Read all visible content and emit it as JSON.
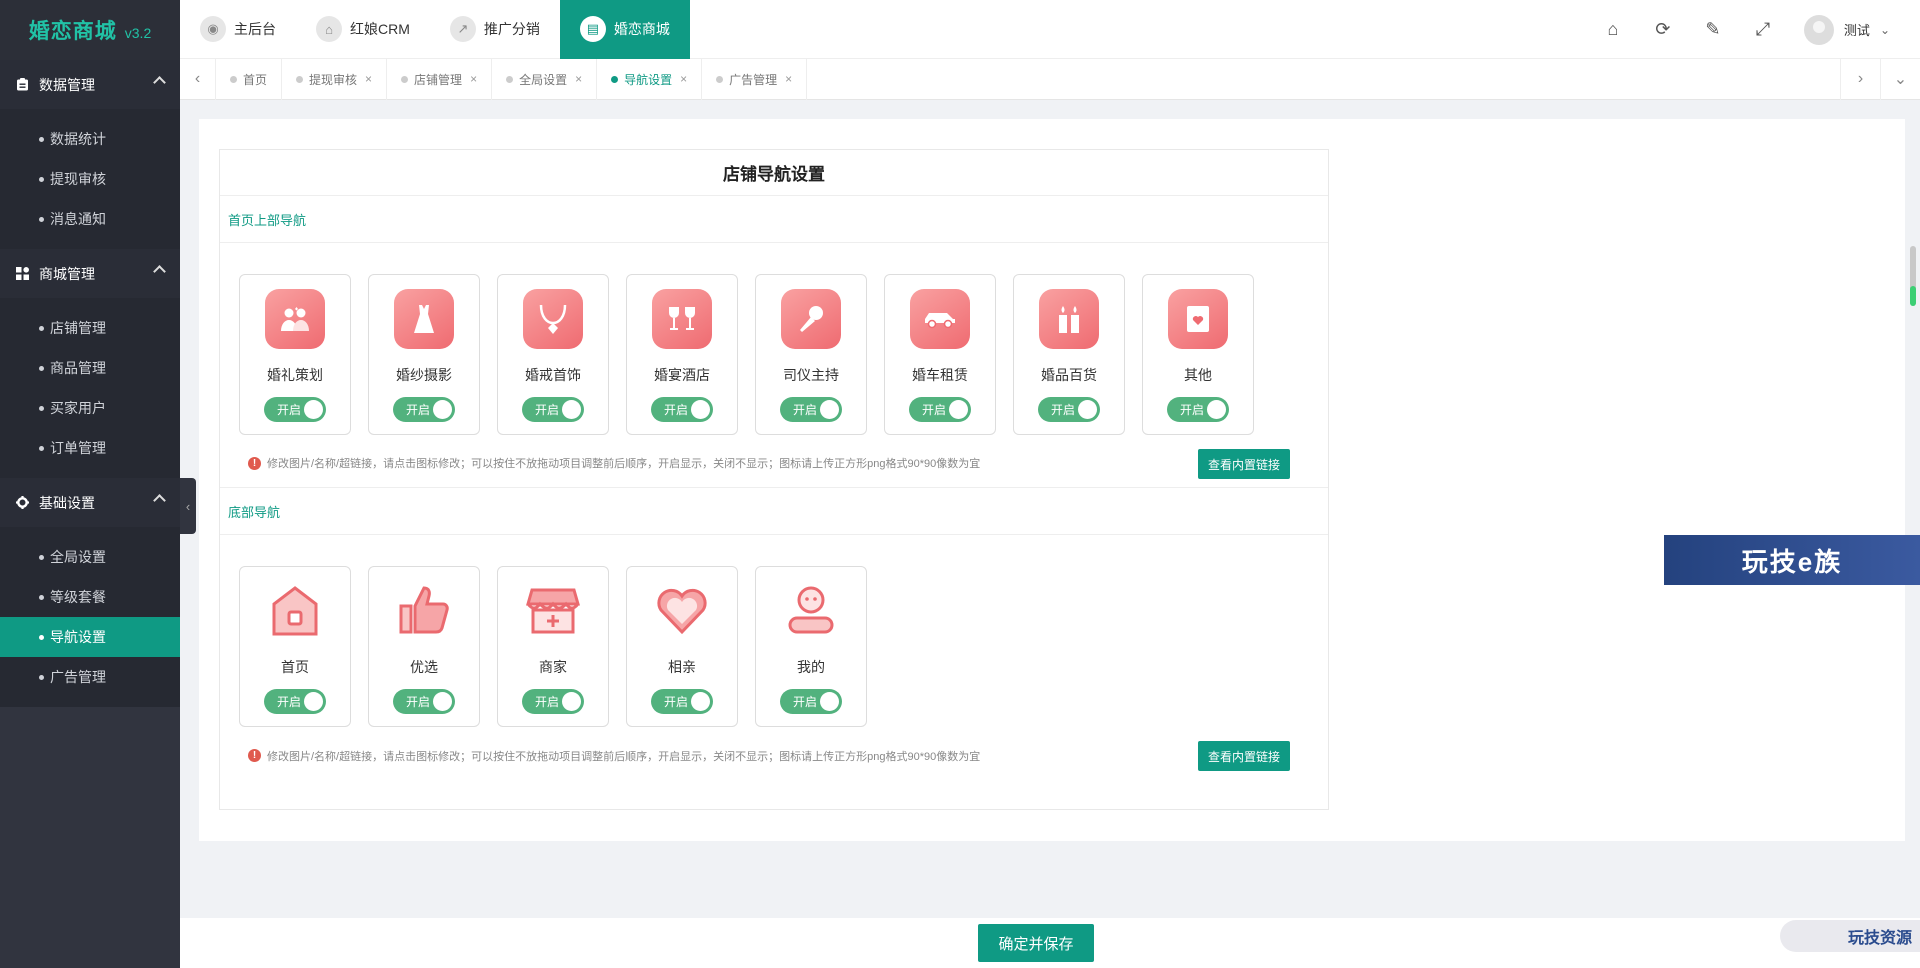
{
  "logo": {
    "name": "婚恋商城",
    "version": "v3.2"
  },
  "sidebar": {
    "groups": [
      {
        "title": "数据管理",
        "items": [
          "数据统计",
          "提现审核",
          "消息通知"
        ]
      },
      {
        "title": "商城管理",
        "items": [
          "店铺管理",
          "商品管理",
          "买家用户",
          "订单管理"
        ]
      },
      {
        "title": "基础设置",
        "items": [
          "全局设置",
          "等级套餐",
          "导航设置",
          "广告管理"
        ]
      }
    ],
    "active_item": "导航设置"
  },
  "topnav": {
    "items": [
      "主后台",
      "红娘CRM",
      "推广分销",
      "婚恋商城"
    ],
    "active": "婚恋商城",
    "user": "测试"
  },
  "tabs": {
    "items": [
      "首页",
      "提现审核",
      "店铺管理",
      "全局设置",
      "导航设置",
      "广告管理"
    ],
    "active": "导航设置"
  },
  "panel": {
    "title": "店铺导航设置",
    "top_section": {
      "label": "首页上部导航",
      "items": [
        {
          "name": "婚礼策划",
          "icon": "couple-icon",
          "toggle": "开启"
        },
        {
          "name": "婚纱摄影",
          "icon": "dress-icon",
          "toggle": "开启"
        },
        {
          "name": "婚戒首饰",
          "icon": "necklace-icon",
          "toggle": "开启"
        },
        {
          "name": "婚宴酒店",
          "icon": "wine-glasses-icon",
          "toggle": "开启"
        },
        {
          "name": "司仪主持",
          "icon": "microphone-icon",
          "toggle": "开启"
        },
        {
          "name": "婚车租赁",
          "icon": "car-icon",
          "toggle": "开启"
        },
        {
          "name": "婚品百货",
          "icon": "candles-icon",
          "toggle": "开启"
        },
        {
          "name": "其他",
          "icon": "card-heart-icon",
          "toggle": "开启"
        }
      ],
      "hint": "修改图片/名称/超链接，请点击图标修改；可以按住不放拖动项目调整前后顺序，开启显示，关闭不显示；图标请上传正方形png格式90*90像数为宜",
      "link_button": "查看内置链接"
    },
    "bottom_section": {
      "label": "底部导航",
      "items": [
        {
          "name": "首页",
          "icon": "home-icon",
          "toggle": "开启"
        },
        {
          "name": "优选",
          "icon": "thumbs-up-icon",
          "toggle": "开启"
        },
        {
          "name": "商家",
          "icon": "shop-icon",
          "toggle": "开启"
        },
        {
          "name": "相亲",
          "icon": "heart-icon",
          "toggle": "开启"
        },
        {
          "name": "我的",
          "icon": "user-icon",
          "toggle": "开启"
        }
      ],
      "hint": "修改图片/名称/超链接，请点击图标修改；可以按住不放拖动项目调整前后顺序，开启显示，关闭不显示；图标请上传正方形png格式90*90像数为宜",
      "link_button": "查看内置链接"
    }
  },
  "save_button": "确定并保存",
  "watermarks": {
    "banner": "玩技e族",
    "corner": "玩技资源"
  },
  "colors": {
    "primary": "#0f9a84",
    "toggle": "#52b27e",
    "icon_gradient_start": "#f9a1a1",
    "icon_gradient_end": "#ef6b71"
  }
}
